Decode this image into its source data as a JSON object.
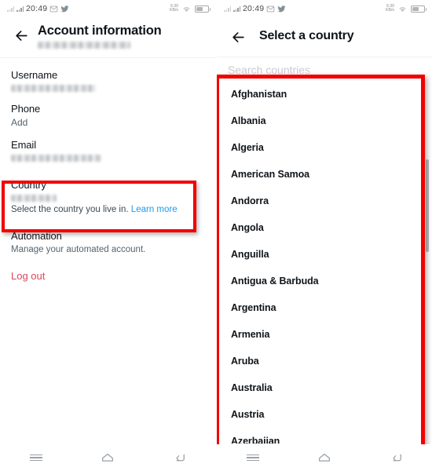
{
  "status_bar": {
    "time": "20:49",
    "net_speed_top": "9.30",
    "net_speed_bottom": "KB/s",
    "icons": [
      "signal-faint-icon",
      "signal-icon",
      "message-icon",
      "twitter-bird-icon",
      "wifi-icon",
      "battery-icon"
    ]
  },
  "left_screen": {
    "title": "Account information",
    "subtitle_redacted": true,
    "back_label": "Back",
    "sections": [
      {
        "label": "Username",
        "value_redacted": true,
        "sub": ""
      },
      {
        "label": "Phone",
        "value": "Add",
        "sub": ""
      },
      {
        "label": "Email",
        "value_redacted": true,
        "sub": ""
      },
      {
        "label": "Country",
        "value_redacted": true,
        "sub": "Select the country you live in.",
        "link": "Learn more"
      },
      {
        "label": "Automation",
        "sub": "Manage your automated account."
      }
    ],
    "logout_label": "Log out",
    "highlight_target": "Country"
  },
  "right_screen": {
    "title": "Select a country",
    "back_label": "Back",
    "search_placeholder": "Search countries",
    "countries": [
      "Afghanistan",
      "Albania",
      "Algeria",
      "American Samoa",
      "Andorra",
      "Angola",
      "Anguilla",
      "Antigua & Barbuda",
      "Argentina",
      "Armenia",
      "Aruba",
      "Australia",
      "Austria",
      "Azerbaijan"
    ]
  },
  "nav_bar": {
    "recents_label": "Recents",
    "home_label": "Home",
    "back_label": "Back"
  },
  "colors": {
    "highlight": "#f20000",
    "link": "#1d9bf0",
    "logout": "#d9485c",
    "text_primary": "#0f1419",
    "text_secondary": "#536471"
  }
}
